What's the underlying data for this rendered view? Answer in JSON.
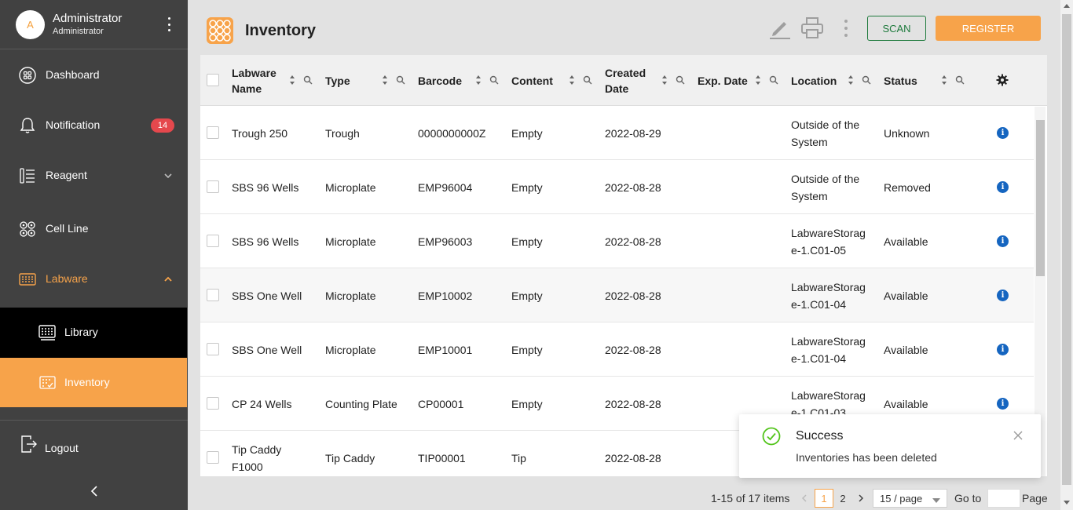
{
  "sidebar": {
    "avatar_letter": "A",
    "user_name": "Administrator",
    "user_role": "Administrator",
    "nav": {
      "dashboard": "Dashboard",
      "notification": "Notification",
      "notification_count": "14",
      "reagent": "Reagent",
      "cell_line": "Cell Line",
      "labware": "Labware",
      "library": "Library",
      "inventory": "Inventory",
      "logout": "Logout"
    }
  },
  "header": {
    "title": "Inventory",
    "scan_label": "SCAN",
    "register_label": "REGISTER"
  },
  "table": {
    "columns": {
      "labware_name_1": "Labware",
      "labware_name_2": "Name",
      "type": "Type",
      "barcode": "Barcode",
      "content": "Content",
      "created_date_1": "Created",
      "created_date_2": "Date",
      "exp_date": "Exp. Date",
      "location": "Location",
      "status": "Status"
    },
    "rows": [
      {
        "name": "Trough 250",
        "type": "Trough",
        "barcode": "0000000000Z",
        "content": "Empty",
        "created": "2022-08-29",
        "exp": "",
        "location": "Outside of the System",
        "status": "Unknown"
      },
      {
        "name": "SBS 96 Wells",
        "type": "Microplate",
        "barcode": "EMP96004",
        "content": "Empty",
        "created": "2022-08-28",
        "exp": "",
        "location": "Outside of the System",
        "status": "Removed"
      },
      {
        "name": "SBS 96 Wells",
        "type": "Microplate",
        "barcode": "EMP96003",
        "content": "Empty",
        "created": "2022-08-28",
        "exp": "",
        "location": "LabwareStorage-1.C01-05",
        "status": "Available"
      },
      {
        "name": "SBS One Well",
        "type": "Microplate",
        "barcode": "EMP10002",
        "content": "Empty",
        "created": "2022-08-28",
        "exp": "",
        "location": "LabwareStorage-1.C01-04",
        "status": "Available"
      },
      {
        "name": "SBS One Well",
        "type": "Microplate",
        "barcode": "EMP10001",
        "content": "Empty",
        "created": "2022-08-28",
        "exp": "",
        "location": "LabwareStorage-1.C01-04",
        "status": "Available"
      },
      {
        "name": "CP 24 Wells",
        "type": "Counting Plate",
        "barcode": "CP00001",
        "content": "Empty",
        "created": "2022-08-28",
        "exp": "",
        "location": "LabwareStorage-1.C01-03",
        "status": "Available"
      },
      {
        "name": "Tip Caddy F1000",
        "type": "Tip Caddy",
        "barcode": "TIP00001",
        "content": "Tip",
        "created": "2022-08-28",
        "exp": "",
        "location": "",
        "status": ""
      }
    ]
  },
  "pagination": {
    "total": "1-15 of 17 items",
    "current": "1",
    "next_page": "2",
    "page_size": "15 / page",
    "goto_label": "Go to",
    "page_label": "Page"
  },
  "toast": {
    "title": "Success",
    "message": "Inventories has been deleted"
  },
  "colors": {
    "accent": "#f7a34a",
    "sidebar_bg": "#414141",
    "active_submenu": "#000000",
    "badge": "#e5484d",
    "scan_border": "#1e7a3c",
    "info": "#1565c0",
    "success": "#52c41a"
  },
  "icons": {
    "dashboard": "dashboard-icon",
    "notification": "bell-icon",
    "reagent": "reagent-icon",
    "cell_line": "cell-line-icon",
    "labware": "labware-icon",
    "library": "library-icon",
    "inventory": "inventory-icon",
    "logout": "logout-icon",
    "edit": "pencil-icon",
    "print": "printer-icon",
    "search": "search-icon",
    "sort": "sort-icon",
    "settings": "gear-icon",
    "info": "info-icon",
    "success": "check-circle-icon"
  }
}
